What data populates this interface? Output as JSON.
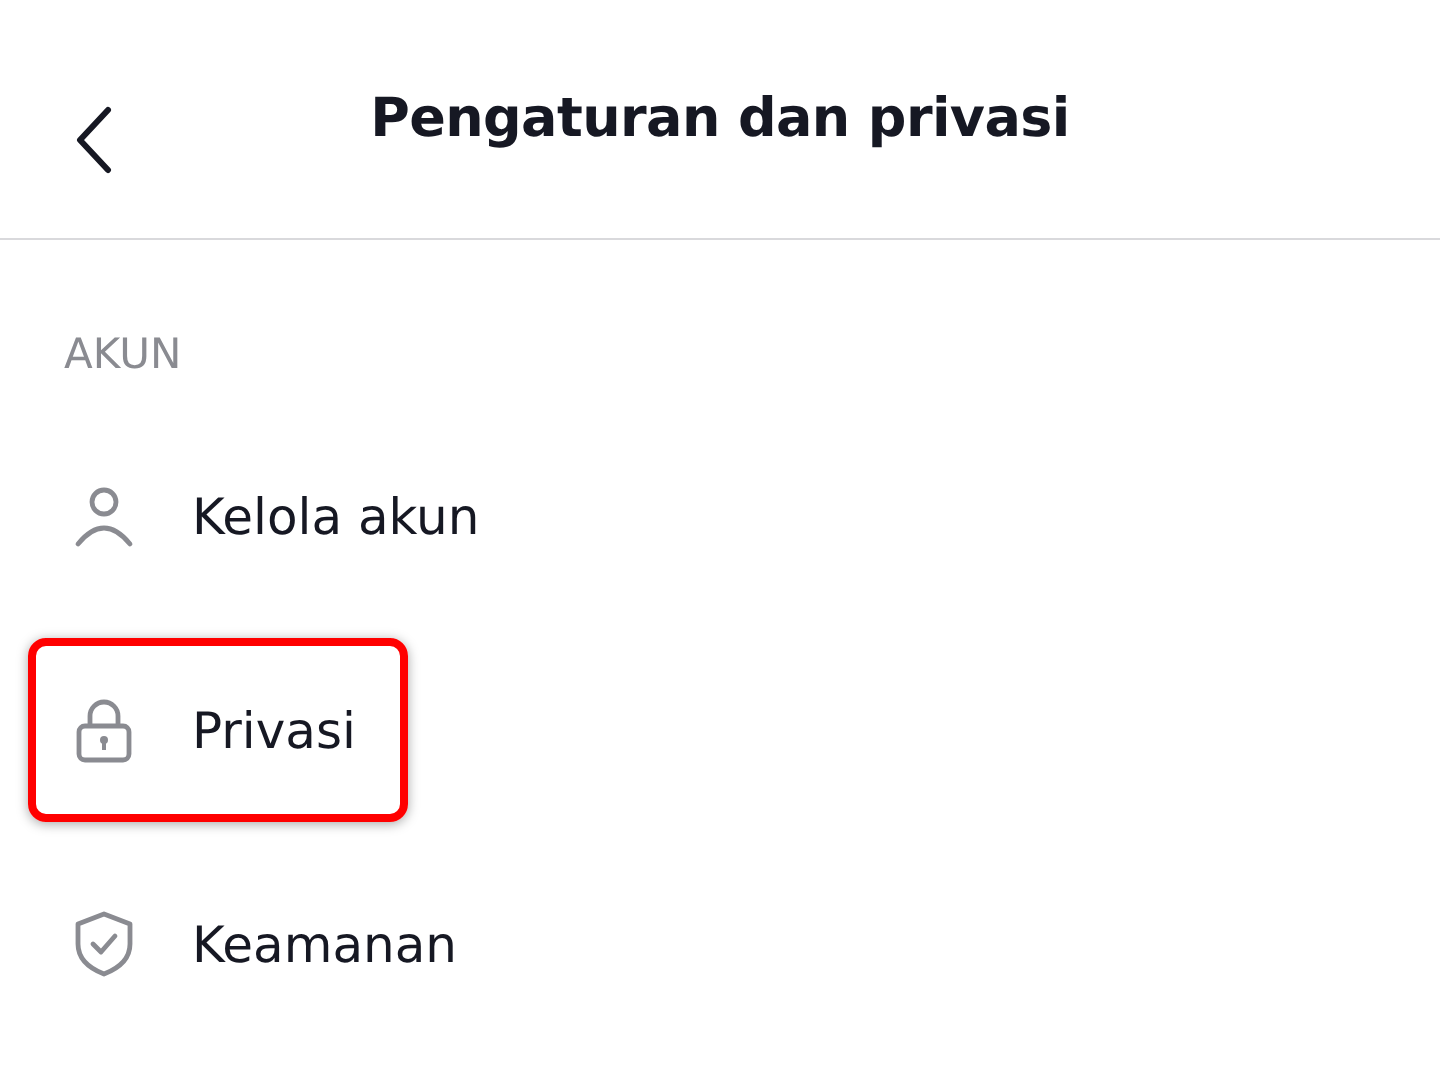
{
  "header": {
    "title": "Pengaturan dan privasi"
  },
  "section": {
    "label": "AKUN"
  },
  "items": [
    {
      "kind": "person",
      "label": "Kelola akun",
      "highlighted": false
    },
    {
      "kind": "lock",
      "label": "Privasi",
      "highlighted": true
    },
    {
      "kind": "shield",
      "label": "Keamanan",
      "highlighted": false
    }
  ]
}
